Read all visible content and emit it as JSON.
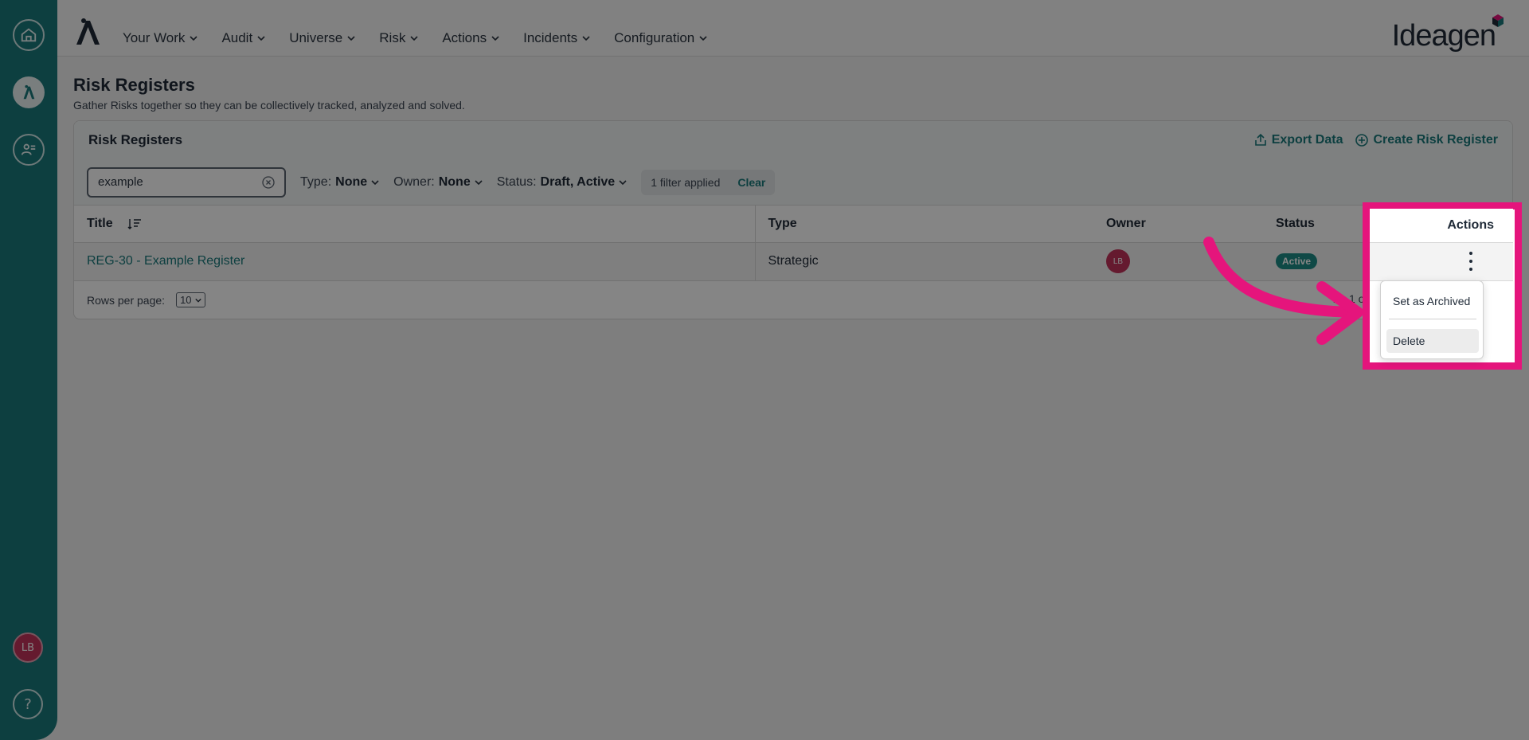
{
  "rail": {
    "avatar_initials": "LB",
    "help_label": "?"
  },
  "nav": {
    "items": [
      "Your Work",
      "Audit",
      "Universe",
      "Risk",
      "Actions",
      "Incidents",
      "Configuration"
    ],
    "brand": "Ideagen"
  },
  "page": {
    "title": "Risk Registers",
    "subtitle": "Gather Risks together so they can be collectively tracked, analyzed and solved."
  },
  "card": {
    "title": "Risk Registers",
    "export_label": "Export Data",
    "create_label": "Create Risk Register"
  },
  "filters": {
    "search_value": "example",
    "type_label": "Type:",
    "type_value": "None",
    "owner_label": "Owner:",
    "owner_value": "None",
    "status_label": "Status:",
    "status_value": "Draft, Active",
    "applied_text": "1 filter applied",
    "clear_label": "Clear"
  },
  "table": {
    "headers": {
      "title": "Title",
      "type": "Type",
      "owner": "Owner",
      "status": "Status",
      "actions": "Actions"
    },
    "rows": [
      {
        "title": "REG-30 - Example Register",
        "type": "Strategic",
        "owner_initials": "LB",
        "status": "Active"
      }
    ]
  },
  "footer": {
    "rows_per_page_label": "Rows per page:",
    "rows_per_page_value": "10",
    "pager_text": "1 - 1 of 1"
  },
  "menu": {
    "archive_label": "Set as Archived",
    "delete_label": "Delete"
  },
  "colors": {
    "accent": "#1a7a7c",
    "highlight": "#e5157c"
  }
}
